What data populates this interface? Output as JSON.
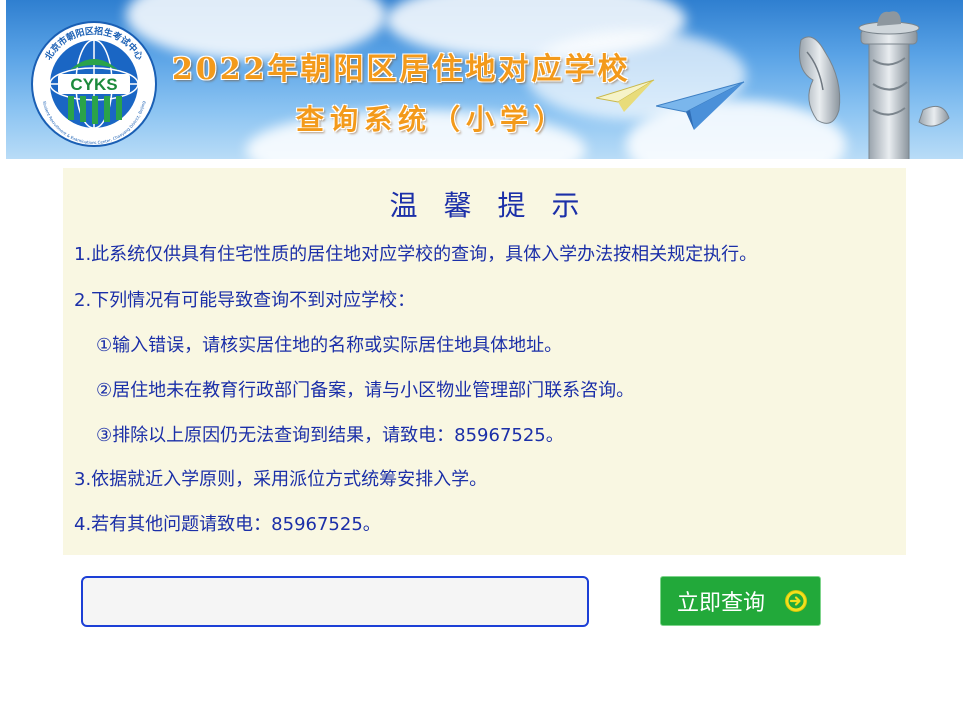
{
  "banner": {
    "title_line1": "2022年朝阳区居住地对应学校",
    "title_line2": "查询系统（小学）",
    "logo": {
      "acronym": "CYKS",
      "ring_text": "北京市朝阳区招生考试中心",
      "english_text": "Student Recruitment & Examinations Center, Chaoyang District, Beijing"
    }
  },
  "notice": {
    "title": "温馨提示",
    "items": [
      "1.此系统仅供具有住宅性质的居住地对应学校的查询，具体入学办法按相关规定执行。",
      "2.下列情况有可能导致查询不到对应学校：",
      "①输入错误，请核实居住地的名称或实际居住地具体地址。",
      "②居住地未在教育行政部门备案，请与小区物业管理部门联系咨询。",
      "③排除以上原因仍无法查询到结果，请致电：85967525。",
      "3.依据就近入学原则，采用派位方式统筹安排入学。",
      "4.若有其他问题请致电：85967525。"
    ]
  },
  "search": {
    "value": "",
    "placeholder": "",
    "button_label": "立即查询",
    "button_icon": "arrow-right-circle-icon"
  },
  "colors": {
    "notice_text": "#1b2fa8",
    "notice_bg": "#f9f7e2",
    "title_orange": "#f39a1b",
    "button_green": "#22a93a",
    "input_border": "#1c3fd6"
  }
}
